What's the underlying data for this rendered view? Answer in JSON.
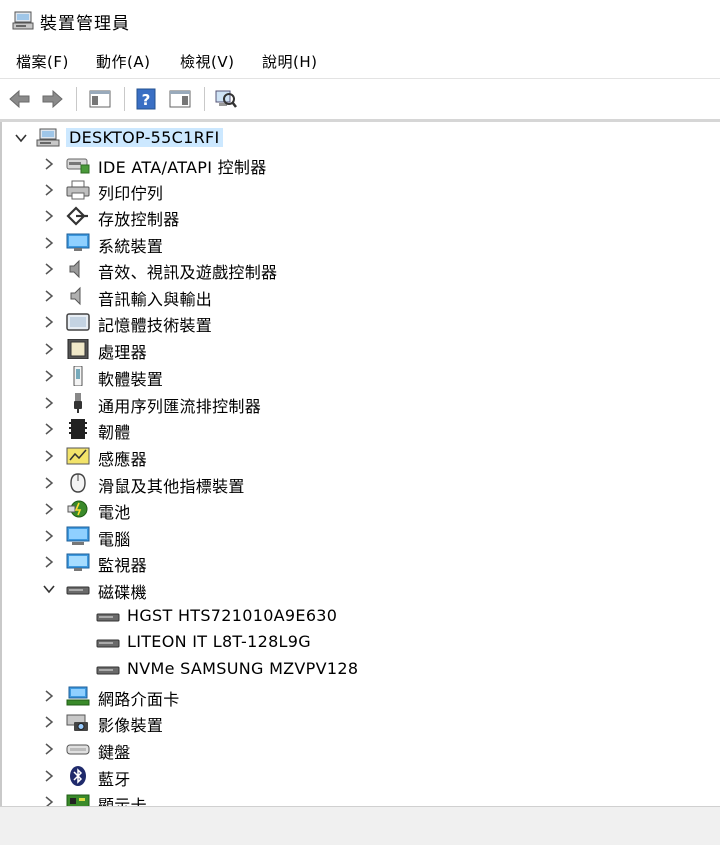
{
  "window": {
    "title": "裝置管理員",
    "icon": "device-manager-icon"
  },
  "menu": {
    "items": [
      "檔案(F)",
      "動作(A)",
      "檢視(V)",
      "說明(H)"
    ]
  },
  "toolbar": {
    "buttons": [
      "back-arrow-icon",
      "forward-arrow-icon",
      "show-hide-console-tree-icon",
      "help-icon",
      "action-pane-icon",
      "scan-hardware-icon"
    ]
  },
  "tree": {
    "root": {
      "label": "DESKTOP-55C1RFI",
      "icon": "computer-icon",
      "expanded": true,
      "selected": true
    },
    "categories": [
      {
        "label": "IDE ATA/ATAPI 控制器",
        "icon": "ide-controller-icon",
        "expanded": false
      },
      {
        "label": "列印佇列",
        "icon": "printer-icon",
        "expanded": false
      },
      {
        "label": "存放控制器",
        "icon": "storage-controller-icon",
        "expanded": false
      },
      {
        "label": "系統裝置",
        "icon": "system-device-icon",
        "expanded": false
      },
      {
        "label": "音效、視訊及遊戲控制器",
        "icon": "sound-icon",
        "expanded": false
      },
      {
        "label": "音訊輸入與輸出",
        "icon": "audio-io-icon",
        "expanded": false
      },
      {
        "label": "記憶體技術裝置",
        "icon": "memory-technology-icon",
        "expanded": false
      },
      {
        "label": "處理器",
        "icon": "processor-icon",
        "expanded": false
      },
      {
        "label": "軟體裝置",
        "icon": "software-device-icon",
        "expanded": false
      },
      {
        "label": "通用序列匯流排控制器",
        "icon": "usb-icon",
        "expanded": false
      },
      {
        "label": "韌體",
        "icon": "firmware-icon",
        "expanded": false
      },
      {
        "label": "感應器",
        "icon": "sensor-icon",
        "expanded": false
      },
      {
        "label": "滑鼠及其他指標裝置",
        "icon": "mouse-icon",
        "expanded": false
      },
      {
        "label": "電池",
        "icon": "battery-icon",
        "expanded": false
      },
      {
        "label": "電腦",
        "icon": "computer-monitor-icon",
        "expanded": false
      },
      {
        "label": "監視器",
        "icon": "monitor-icon",
        "expanded": false
      },
      {
        "label": "磁碟機",
        "icon": "disk-drive-icon",
        "expanded": true,
        "children": [
          {
            "label": "HGST HTS721010A9E630",
            "icon": "disk-drive-icon"
          },
          {
            "label": "LITEON IT L8T-128L9G",
            "icon": "disk-drive-icon"
          },
          {
            "label": "NVMe SAMSUNG MZVPV128",
            "icon": "disk-drive-icon"
          }
        ]
      },
      {
        "label": "網路介面卡",
        "icon": "network-adapter-icon",
        "expanded": false
      },
      {
        "label": "影像裝置",
        "icon": "imaging-device-icon",
        "expanded": false
      },
      {
        "label": "鍵盤",
        "icon": "keyboard-icon",
        "expanded": false
      },
      {
        "label": "藍牙",
        "icon": "bluetooth-icon",
        "expanded": false
      },
      {
        "label": "顯示卡",
        "icon": "display-adapter-icon",
        "expanded": false
      }
    ]
  },
  "colors": {
    "selection": "#cce8ff",
    "statusbar": "#f0f0f0"
  }
}
